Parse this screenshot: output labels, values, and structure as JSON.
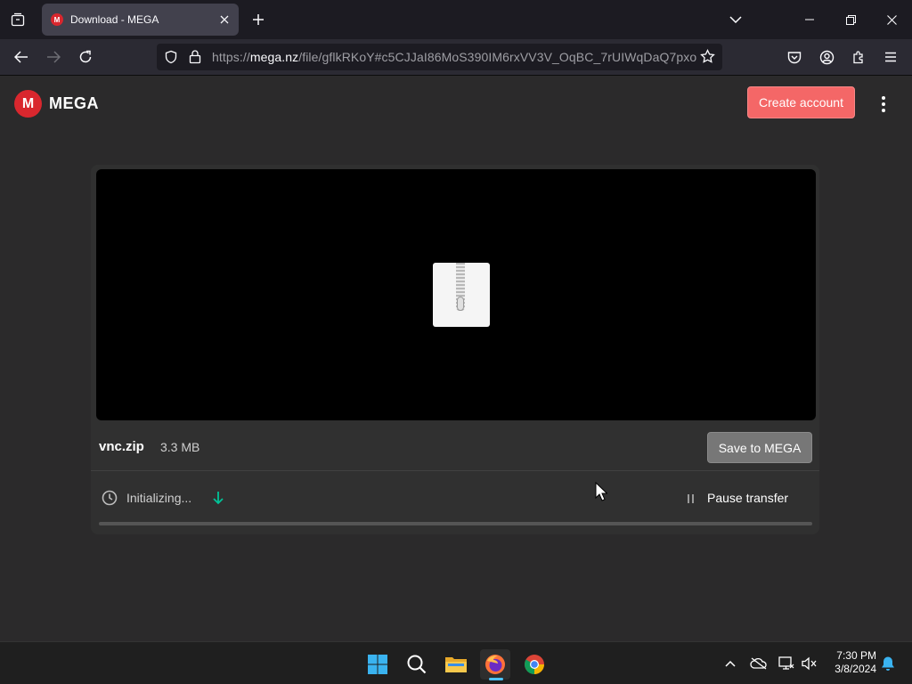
{
  "browser": {
    "tab_title": "Download - MEGA",
    "tab_favicon_letter": "M",
    "url_prefix": "https://",
    "url_domain": "mega.nz",
    "url_path": "/file/gflkRKoY#c5CJJaI86MoS390IM6rxVV3V_OqBC_7rUIWqDaQ7pxo"
  },
  "header": {
    "logo_letter": "M",
    "logo_text": "MEGA",
    "create_account_label": "Create account"
  },
  "file": {
    "name": "vnc.zip",
    "size": "3.3 MB",
    "save_label": "Save to MEGA",
    "status": "Initializing...",
    "pause_label": "Pause transfer",
    "progress_percent": 0
  },
  "taskbar": {
    "time": "7:30 PM",
    "date": "3/8/2024"
  },
  "colors": {
    "mega_red": "#d9272e",
    "create_account_bg": "#f46767",
    "accent_green": "#00c398"
  },
  "icons": {
    "tabstrip": [
      "tab-list-icon",
      "close-icon",
      "plus-icon",
      "chevron-down-icon",
      "minimize-icon",
      "restore-icon",
      "close-icon"
    ],
    "navbar": [
      "back-arrow-icon",
      "forward-arrow-icon",
      "reload-icon",
      "shield-icon",
      "lock-icon",
      "star-icon",
      "pocket-icon",
      "account-icon",
      "extensions-icon",
      "menu-icon"
    ],
    "taskbar": [
      "windows-start-icon",
      "search-icon",
      "file-explorer-icon",
      "firefox-icon",
      "chrome-icon",
      "chevron-up-icon",
      "onedrive-icon",
      "network-icon",
      "volume-muted-icon",
      "bell-icon"
    ]
  }
}
